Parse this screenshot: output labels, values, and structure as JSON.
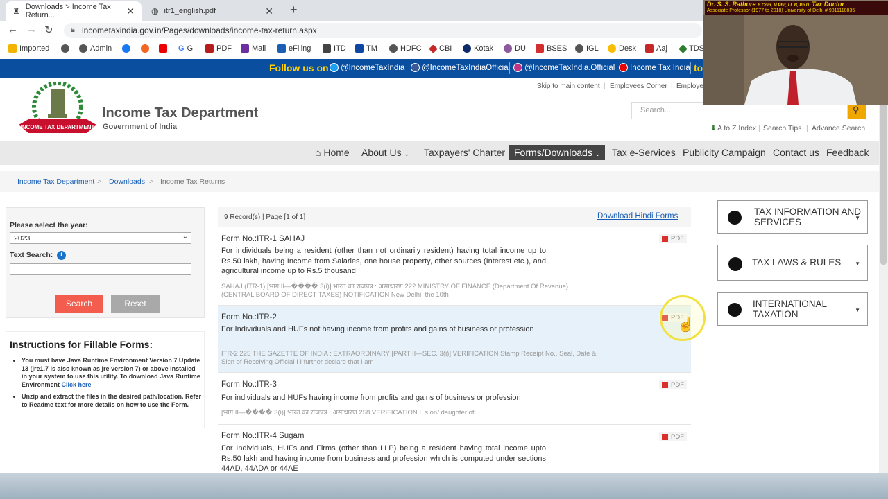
{
  "browser": {
    "tabs": [
      {
        "label": "Downloads > Income Tax Return..."
      },
      {
        "label": "itr1_english.pdf"
      }
    ],
    "new_tab": "+",
    "url": "incometaxindia.gov.in/Pages/downloads/income-tax-return.aspx",
    "bookmarks": [
      "Imported",
      "Admin",
      "PDF",
      "Mail",
      "eFiling",
      "ITD",
      "TM",
      "HDFC",
      "CBI",
      "Kotak",
      "DU",
      "BSES",
      "IGL",
      "Desk",
      "Aaj",
      "TDS"
    ],
    "bookmark_g": "G",
    "bookmark_g2": "G"
  },
  "followbar": {
    "follow": "Follow us on",
    "items": [
      "@IncomeTaxIndia",
      "@IncomeTaxIndiaOfficial",
      "@IncomeTaxIndia.Official",
      "Income Tax India"
    ],
    "to": "to"
  },
  "header": {
    "emblem_text": "INCOME TAX DEPARTMENT",
    "title": "Income Tax Department",
    "subtitle": "Government of India",
    "toplinks": [
      "Skip to main content",
      "Employees Corner",
      "Employe"
    ],
    "search_placeholder": "Search...",
    "links": [
      "A to Z Index",
      "Search Tips",
      "Advance Search"
    ]
  },
  "nav": {
    "items": [
      "Home",
      "About Us",
      "Taxpayers' Charter",
      "Forms/Downloads",
      "Tax e-Services",
      "Publicity Campaign",
      "Contact us",
      "Feedback"
    ]
  },
  "breadcrumb": [
    "Income Tax Department",
    "Downloads",
    "Income Tax Returns"
  ],
  "filter": {
    "year_label": "Please select the year:",
    "year_value": "2023",
    "text_label": "Text Search:",
    "search_btn": "Search",
    "reset_btn": "Reset"
  },
  "instructions": {
    "title": "Instructions for Fillable Forms:",
    "item1": "You must have Java Runtime Environment Version 7 Update 13 (jre1.7 is also known as jre version 7) or above installed in your system to use this utility. To download Java Runtime Environment",
    "item1_link": "Click here",
    "item2": "Unzip and extract the files in the desired path/location. Refer to Readme text for more details on how to use the Form."
  },
  "records": {
    "summary": "9 Record(s) | Page [1 of 1]",
    "hindi_link": "Download Hindi Forms",
    "pdf_label": "PDF",
    "items": [
      {
        "form": "Form No.:ITR-1 SAHAJ",
        "desc": "For individuals being a resident (other than not ordinarily resident) having total income up to Rs.50 lakh, having Income from Salaries, one house property, other sources (Interest etc.), and agricultural income up to Rs.5 thousand",
        "snippet": "SAHAJ (ITR-1) [भाग II—���� 3(i)] भारत का राजपत्र : असाधारण 222 MINISTRY OF FINANCE (Department Of Revenue) (CENTRAL BOARD OF DIRECT TAXES) NOTIFICATION New Delhi, the 10th"
      },
      {
        "form": "Form No.:ITR-2",
        "desc": "For Individuals and HUFs not having income from profits and gains of business or profession",
        "snippet": "ITR-2 225 THE GAZETTE OF INDIA : EXTRAORDINARY [PART II—SEC. 3(i)] VERIFICATION Stamp Receipt No., Seal, Date & Sign of Receiving Official I I further declare that I am"
      },
      {
        "form": "Form No.:ITR-3",
        "desc": "For individuals and HUFs having income from profits and gains of business or profession",
        "snippet": "[भाग II—���� 3(i)] भारत का राजपत्र : असाधारण 258 VERIFICATION I, s on/ daughter of"
      },
      {
        "form": "Form No.:ITR-4 Sugam",
        "desc": "For Individuals, HUFs and Firms (other than LLP) being a resident having total income upto Rs.50 lakh and having income from business and profession which is computed under sections 44AD, 44ADA or 44AE",
        "snippet": ""
      }
    ]
  },
  "sidebar": {
    "boxes": [
      "TAX INFORMATION AND SERVICES",
      "TAX LAWS & RULES",
      "INTERNATIONAL TAXATION"
    ]
  },
  "webcam": {
    "name": "Dr. S. S. Rathore",
    "quals": "B.Com, M.Phil, LL.B, Ph.D.",
    "tag": "Tax Doctor",
    "line2": "Associate Professor (1977 to 2018) University of Delhi # 9811110835"
  },
  "colors": {
    "followbar": "#0a4ea0",
    "follow_text": "#ffd000",
    "search_btn": "#f35d4e",
    "reset_btn": "#a9a9a9",
    "nav_active": "#444444",
    "link": "#1a5fb4"
  }
}
